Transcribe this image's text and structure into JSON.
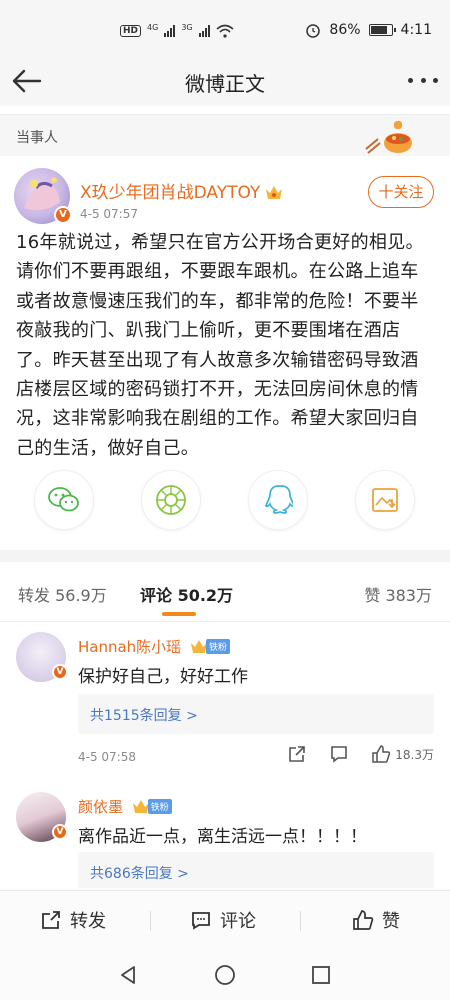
{
  "status_bar": {
    "hd_label": "HD",
    "net_1": "4G",
    "net_2": "3G",
    "battery_text": "86%",
    "battery_level": 0.86,
    "time": "4:11"
  },
  "header": {
    "title": "微博正文",
    "back_icon": "back-arrow-icon",
    "more_icon": "more-dots-icon"
  },
  "context": {
    "label": "当事人",
    "decoration_icon": "hotpot-sticker-icon"
  },
  "post": {
    "author_name": "X玖少年团肖战DAYTOY",
    "time": "4-5 07:57",
    "follow_label": "十关注",
    "verified_mark": "V",
    "body": "16年就说过，希望只在官方公开场合更好的相见。请你们不要再跟组，不要跟车跟机。在公路上追车或者故意慢速压我们的车，都非常的危险！不要半夜敲我的门、趴我门上偷听，更不要围堵在酒店了。昨天甚至出现了有人故意多次输错密码导致酒店楼层区域的密码锁打不开，无法回房间休息的情况，这非常影响我在剧组的工作。希望大家回归自己的生活，做好自己。"
  },
  "share": [
    {
      "icon": "wechat-icon"
    },
    {
      "icon": "moments-icon"
    },
    {
      "icon": "qq-icon"
    },
    {
      "icon": "save-image-icon"
    }
  ],
  "tabs": {
    "repost": "转发 56.9万",
    "comment": "评论 50.2万",
    "like": "赞 383万"
  },
  "comments": [
    {
      "name": "Hannah陈小瑶",
      "fan_label": "铁粉",
      "text": "保护好自己，好好工作",
      "replies": "共1515条回复 >",
      "time": "4-5 07:58",
      "likes": "18.3万"
    },
    {
      "name": "颜依墨",
      "fan_label": "铁粉",
      "text": "离作品近一点，离生活远一点！！！！",
      "replies": "共686条回复 >"
    }
  ],
  "bottom_bar": {
    "repost": "转发",
    "comment": "评论",
    "like": "赞"
  },
  "colors": {
    "accent": "#e86b1f",
    "link": "#4a78c2",
    "tab_indicator": "#f08a1c",
    "fan_badge": "#5b9be8"
  }
}
